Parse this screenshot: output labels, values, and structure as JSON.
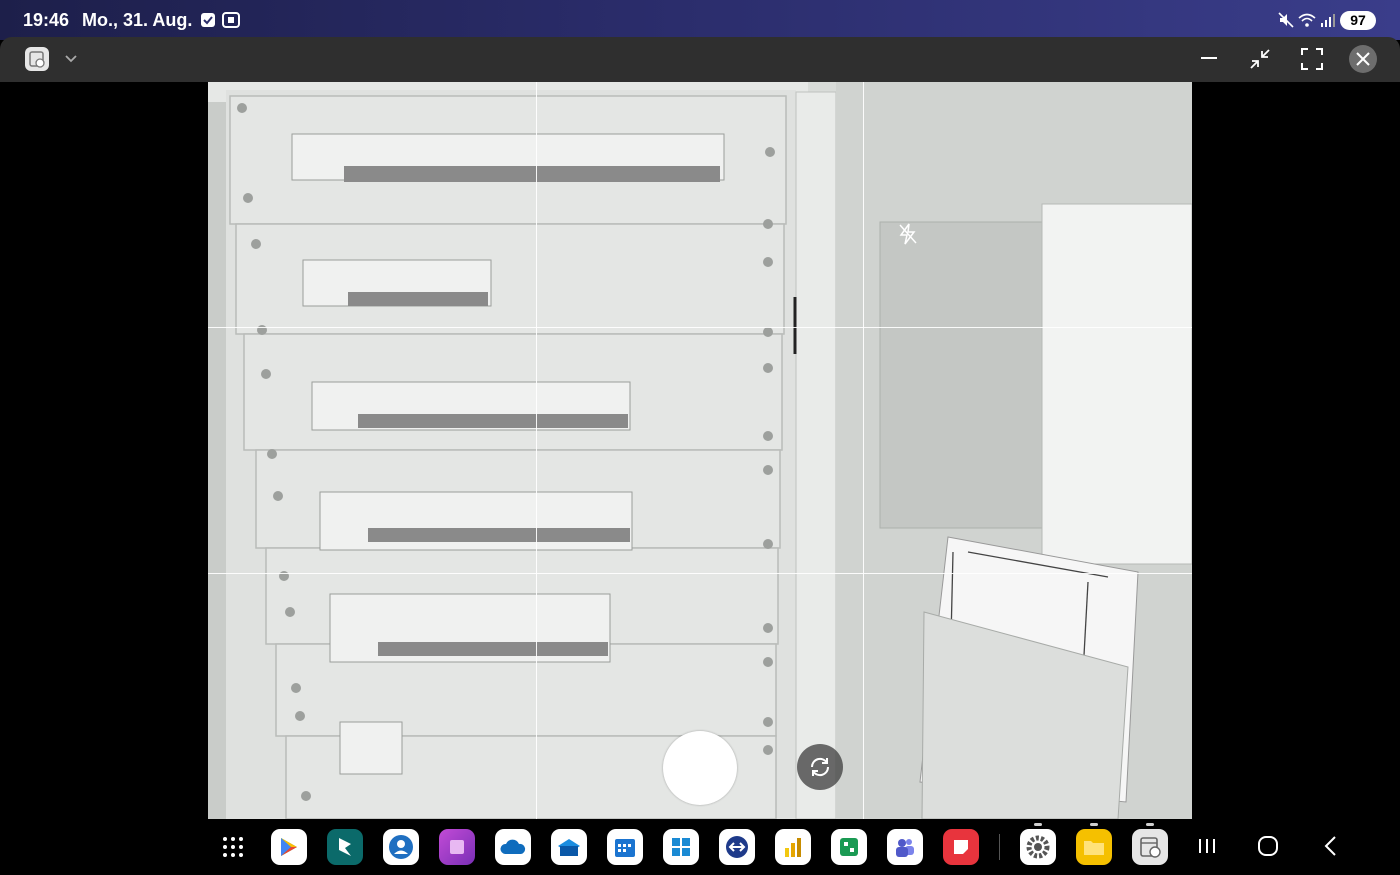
{
  "status_bar": {
    "time": "19:46",
    "date": "Mo., 31. Aug.",
    "battery": "97",
    "icons": [
      "checkbox-icon",
      "screen-record-icon",
      "mute-icon",
      "wifi-icon",
      "signal-icon",
      "battery-icon"
    ]
  },
  "window": {
    "app_icon": "calendar-clock-app-icon",
    "controls": [
      "minimize-icon",
      "restore-icon",
      "fullscreen-icon",
      "close-icon"
    ]
  },
  "camera": {
    "grid": "3x3",
    "flash": "off",
    "controls": [
      "shutter-button",
      "switch-camera-button",
      "flash-off-icon"
    ]
  },
  "taskbar": {
    "apps": [
      {
        "name": "app-drawer",
        "color": "#000000"
      },
      {
        "name": "google-play",
        "color": "#ffffff"
      },
      {
        "name": "dynamics-365",
        "color": "#0b6a6a"
      },
      {
        "name": "contacts-app",
        "color": "#ffffff"
      },
      {
        "name": "power-apps",
        "color": "#a340c9"
      },
      {
        "name": "onedrive",
        "color": "#ffffff"
      },
      {
        "name": "outlook-app",
        "color": "#ffffff"
      },
      {
        "name": "calendar-app",
        "color": "#ffffff"
      },
      {
        "name": "windows-app",
        "color": "#ffffff"
      },
      {
        "name": "remote-app",
        "color": "#ffffff"
      },
      {
        "name": "power-bi",
        "color": "#ffffff"
      },
      {
        "name": "planner-app",
        "color": "#ffffff"
      },
      {
        "name": "teams-app",
        "color": "#ffffff"
      },
      {
        "name": "notes-app",
        "color": "#e8343d"
      },
      {
        "name": "settings-app",
        "color": "#ffffff"
      },
      {
        "name": "files-app",
        "color": "#f5c000"
      },
      {
        "name": "calendar-clock-app",
        "color": "#e6e6e6"
      }
    ],
    "nav": [
      "recents-button",
      "home-button",
      "back-button"
    ]
  }
}
